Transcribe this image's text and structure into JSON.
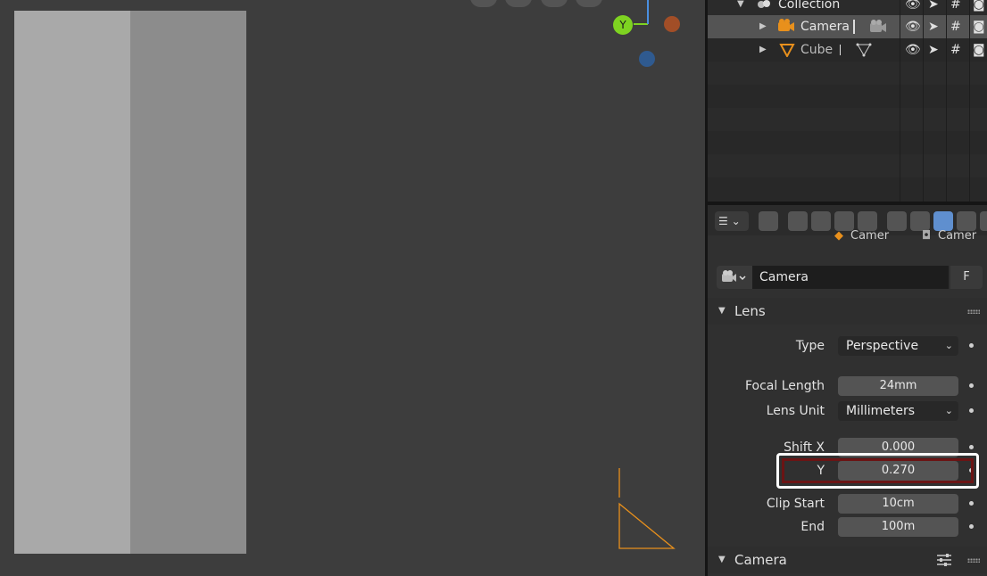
{
  "viewport": {
    "gizmo": {
      "y_label": "Y"
    }
  },
  "outliner": {
    "rows": [
      {
        "label": "Collection",
        "icon": "collection-icon"
      },
      {
        "label": "Camera",
        "icon": "camera-object-icon",
        "selected": true
      },
      {
        "label": "Cube",
        "icon": "mesh-object-icon"
      }
    ]
  },
  "properties": {
    "breadcrumb": [
      "Camer",
      "Camer"
    ],
    "datablock": {
      "name": "Camera",
      "fake_user": "F"
    },
    "lens_panel": {
      "title": "Lens",
      "type_label": "Type",
      "type_value": "Perspective",
      "focal_label": "Focal Length",
      "focal_value": "24mm",
      "lens_unit_label": "Lens Unit",
      "lens_unit_value": "Millimeters",
      "shift_x_label": "Shift X",
      "shift_x_value": "0.000",
      "shift_y_label": "Y",
      "shift_y_value": "0.270",
      "clip_start_label": "Clip Start",
      "clip_start_value": "10cm",
      "clip_end_label": "End",
      "clip_end_value": "100m"
    },
    "camera_panel": {
      "title": "Camera"
    }
  },
  "colors": {
    "viewport_bg": "#3d3d3d",
    "active_tab": "#5f8fcf",
    "highlight": "#6b1414",
    "camera_wire": "#e8901c"
  }
}
